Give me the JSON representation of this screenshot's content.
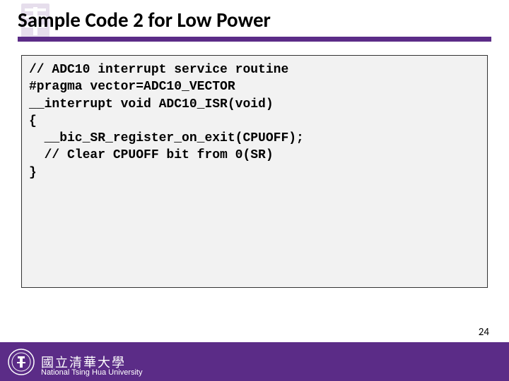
{
  "title": "Sample Code 2 for Low Power",
  "code": "// ADC10 interrupt service routine\n#pragma vector=ADC10_VECTOR\n__interrupt void ADC10_ISR(void)\n{\n  __bic_SR_register_on_exit(CPUOFF);\n  // Clear CPUOFF bit from 0(SR)\n}",
  "footer": {
    "university_cn": "國立清華大學",
    "university_en": "National Tsing Hua University"
  },
  "page_number": "24",
  "colors": {
    "accent": "#5b2c87",
    "code_bg": "#f2f2f2"
  }
}
